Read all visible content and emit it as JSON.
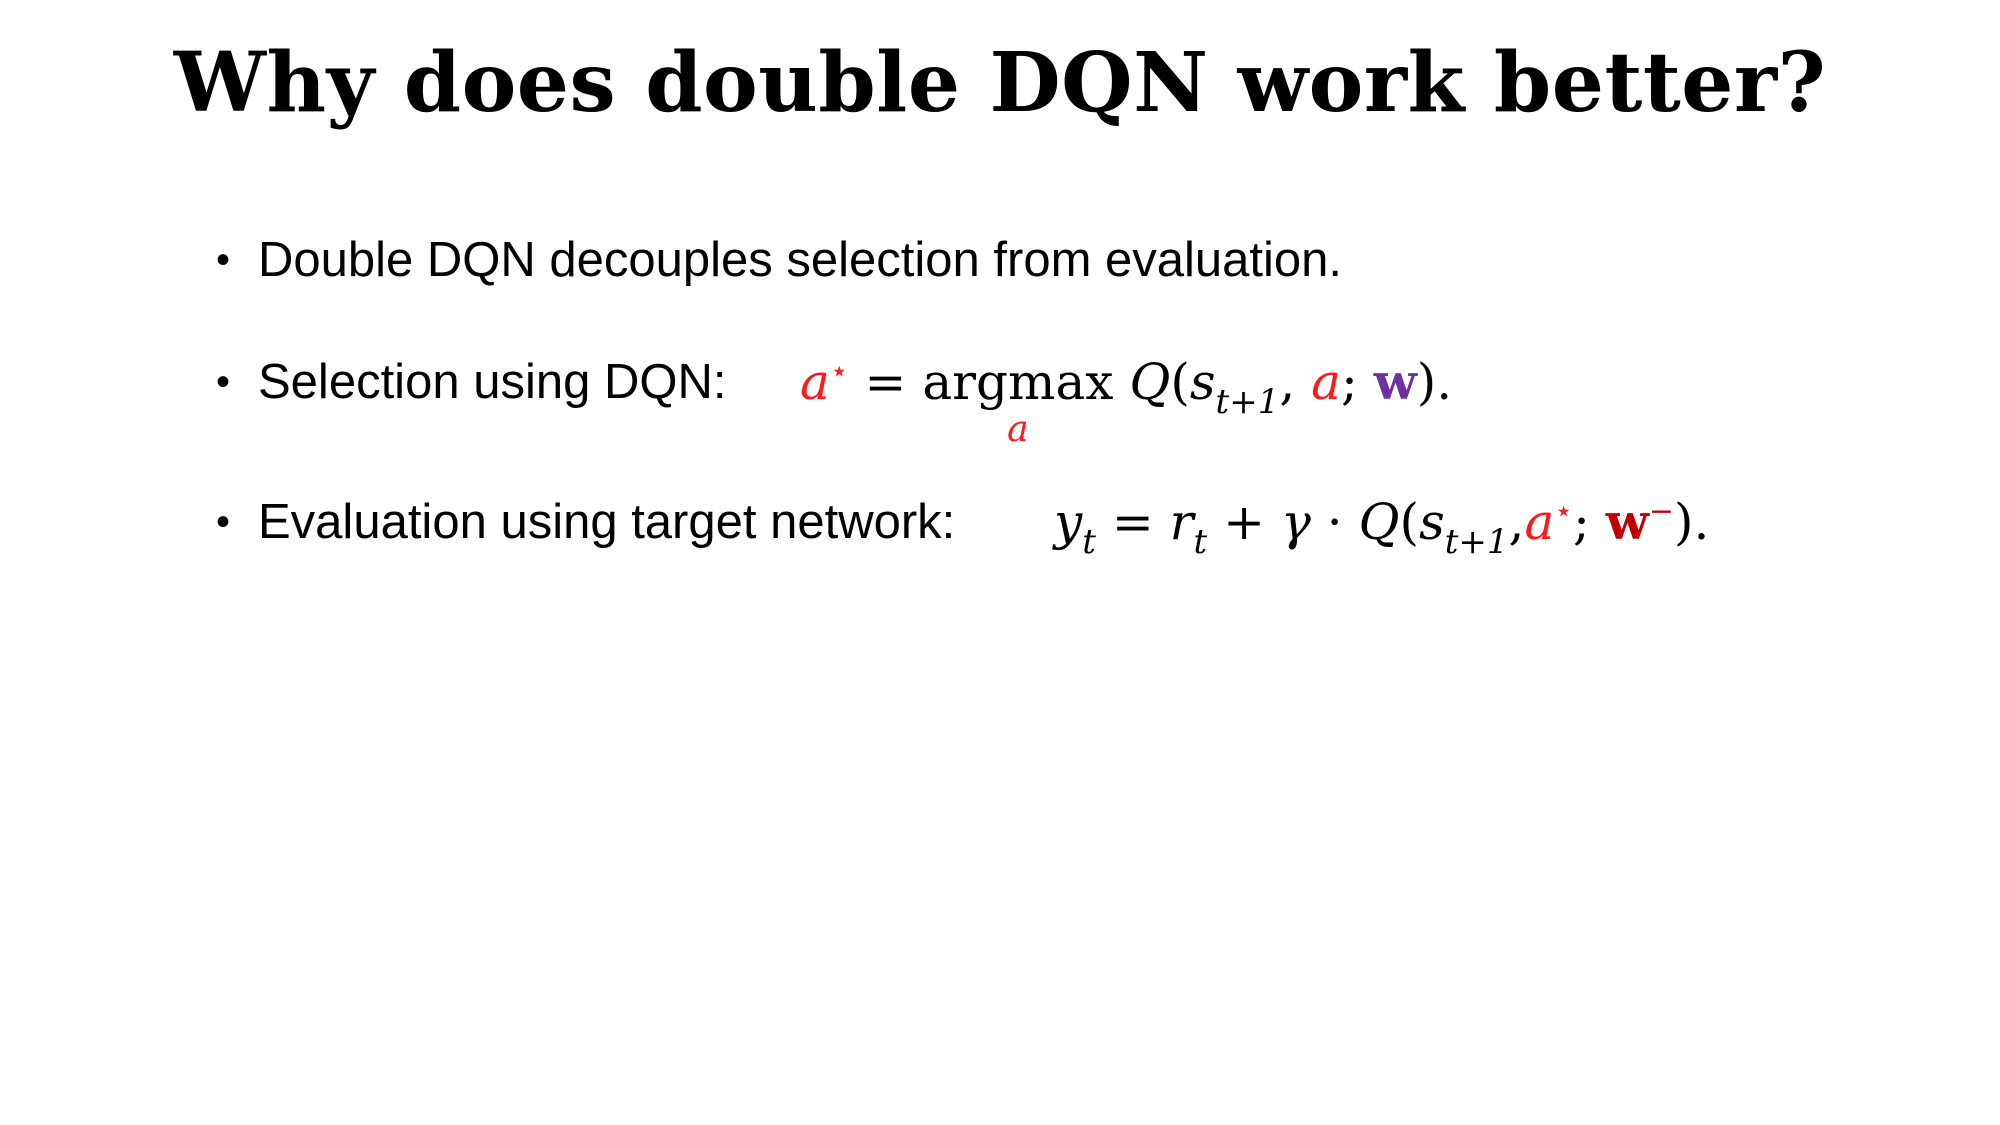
{
  "slide": {
    "title": "Why does double DQN work better?",
    "bullets": [
      {
        "marker": "•",
        "text": "Double DQN decouples selection from evaluation."
      },
      {
        "marker": "•",
        "text": "Selection using DQN:"
      },
      {
        "marker": "•",
        "text": "Evaluation using target network:"
      }
    ],
    "equations": {
      "selection": {
        "lhs": "a",
        "star": "⋆",
        "equals": "=",
        "operator": "argmax",
        "operator_sub": "a",
        "func": "Q",
        "open": "(",
        "state": "s",
        "state_sub": "t+1",
        "comma": ",",
        "action": "a",
        "semicolon": ";",
        "weights": "w",
        "close": ")."
      },
      "evaluation": {
        "lhs": "y",
        "lhs_sub": "t",
        "equals": "=",
        "reward": "r",
        "reward_sub": "t",
        "plus": "+",
        "gamma": "γ",
        "dot": "·",
        "func": "Q",
        "open": "(",
        "state": "s",
        "state_sub": "t+1",
        "comma": ",",
        "action": "a",
        "star": "⋆",
        "semicolon": ";",
        "weights": "w",
        "weights_sup": "−",
        "close": ")."
      }
    },
    "colors": {
      "action_red": "#ff1a1a",
      "dqn_weights_purple": "#7030a0",
      "target_weights_darkred": "#c00000"
    }
  }
}
